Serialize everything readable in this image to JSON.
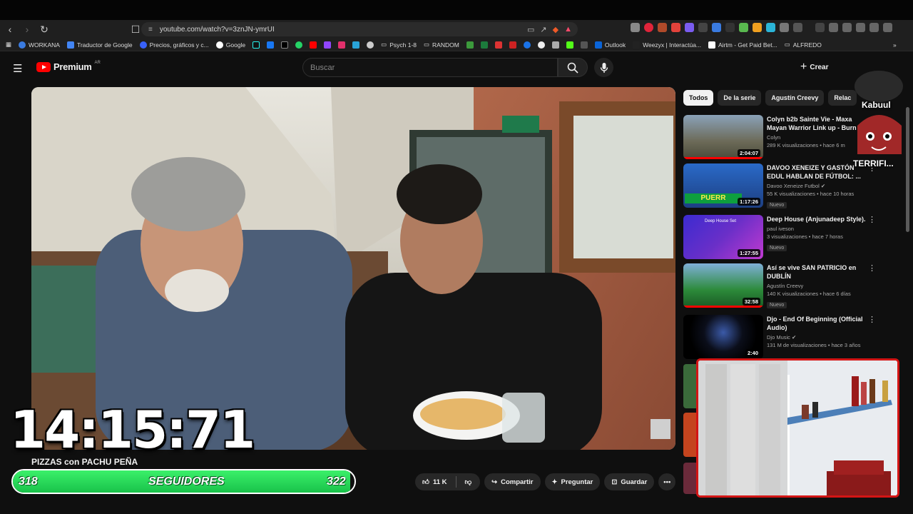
{
  "browser": {
    "url": "youtube.com/watch?v=3znJN-ymrUI",
    "bookmarks": [
      "WORKANA",
      "Traductor de Google",
      "Precios, gráficos y c...",
      "Google",
      "Psych 1-8",
      "RANDOM",
      "Outlook",
      "Weezyx | Interactúa...",
      "Airtm - Get Paid Bet...",
      "ALFREDO"
    ]
  },
  "youtube": {
    "logo_text": "Premium",
    "logo_region": "AR",
    "search_placeholder": "Buscar",
    "create_label": "Crear",
    "video_title": "PIZZAS con PACHU PEÑA",
    "like_count": "11 K",
    "share_label": "Compartir",
    "ask_label": "Preguntar",
    "save_label": "Guardar",
    "chips": [
      "Todos",
      "De la serie",
      "Agustín Creevy",
      "Relac"
    ],
    "recommendations": [
      {
        "title": "Colyn b2b Sainte Vie - Maxa Mayan Warrior Link up - Burn",
        "channel": "Colyn",
        "meta": "289 K visualizaciones • hace 6 m",
        "duration": "2:04:07",
        "badge": ""
      },
      {
        "title": "DAVOO XENEIZE Y GASTÓN EDUL HABLAN DE FÚTBOL: ...",
        "channel": "Davoo Xeneize Futbol",
        "meta": "55 K visualizaciones • hace 10 horas",
        "duration": "1:17:26",
        "badge": "Nuevo"
      },
      {
        "title": "Deep House (Anjunadeep Style).",
        "channel": "paul iveson",
        "meta": "3 visualizaciones • hace 7 horas",
        "duration": "1:27:55",
        "badge": "Nuevo"
      },
      {
        "title": "Así se vive SAN PATRICIO en DUBLÍN",
        "channel": "Agustín Creevy",
        "meta": "140 K visualizaciones • hace 6 días",
        "duration": "32:58",
        "badge": "Nuevo"
      },
      {
        "title": "Djo - End Of Beginning (Official Audio)",
        "channel": "Djo Music",
        "meta": "131 M de visualizaciones • hace 3 años",
        "duration": "2:40",
        "badge": ""
      }
    ]
  },
  "overlay": {
    "timer": "14:15:71",
    "followers_current": "318",
    "followers_label": "SEGUIDORES",
    "followers_goal": "322",
    "followers_progress": 0.988,
    "avatar_name": "Kabuul",
    "avatar_tag": "TERRIFI..."
  },
  "colors": {
    "accent_red": "#ff0000",
    "follower_green": "#22d454",
    "webcam_border": "#d31515"
  }
}
